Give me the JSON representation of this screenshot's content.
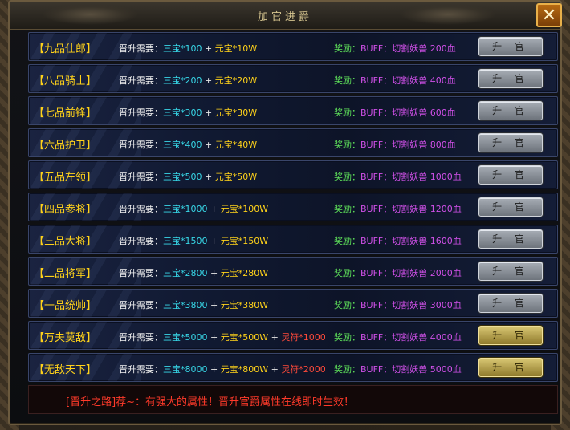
{
  "window": {
    "title": "加官进爵",
    "close_label": "✕"
  },
  "rows": [
    {
      "rank": "【九品仕郎】",
      "req_label": "晋升需要：",
      "sanbao": "三宝*100",
      "plus1": " + ",
      "yuanbao": "元宝*10W",
      "plus2": "",
      "lingfu": "",
      "reward_label": "奖励：",
      "reward_text": "BUFF：切割妖兽 200血",
      "button": "升 官",
      "button_style": "gray"
    },
    {
      "rank": "【八品骑士】",
      "req_label": "晋升需要：",
      "sanbao": "三宝*200",
      "plus1": " + ",
      "yuanbao": "元宝*20W",
      "plus2": "",
      "lingfu": "",
      "reward_label": "奖励：",
      "reward_text": "BUFF：切割妖兽 400血",
      "button": "升 官",
      "button_style": "gray"
    },
    {
      "rank": "【七品前锋】",
      "req_label": "晋升需要：",
      "sanbao": "三宝*300",
      "plus1": " + ",
      "yuanbao": "元宝*30W",
      "plus2": "",
      "lingfu": "",
      "reward_label": "奖励：",
      "reward_text": "BUFF：切割妖兽 600血",
      "button": "升 官",
      "button_style": "gray"
    },
    {
      "rank": "【六品护卫】",
      "req_label": "晋升需要：",
      "sanbao": "三宝*400",
      "plus1": " + ",
      "yuanbao": "元宝*40W",
      "plus2": "",
      "lingfu": "",
      "reward_label": "奖励：",
      "reward_text": "BUFF：切割妖兽 800血",
      "button": "升 官",
      "button_style": "gray"
    },
    {
      "rank": "【五品左领】",
      "req_label": "晋升需要：",
      "sanbao": "三宝*500",
      "plus1": " + ",
      "yuanbao": "元宝*50W",
      "plus2": "",
      "lingfu": "",
      "reward_label": "奖励：",
      "reward_text": "BUFF：切割妖兽 1000血",
      "button": "升 官",
      "button_style": "gray"
    },
    {
      "rank": "【四品参将】",
      "req_label": "晋升需要：",
      "sanbao": "三宝*1000",
      "plus1": " + ",
      "yuanbao": "元宝*100W",
      "plus2": "",
      "lingfu": "",
      "reward_label": "奖励：",
      "reward_text": "BUFF：切割妖兽 1200血",
      "button": "升 官",
      "button_style": "gray"
    },
    {
      "rank": "【三品大将】",
      "req_label": "晋升需要：",
      "sanbao": "三宝*1500",
      "plus1": " + ",
      "yuanbao": "元宝*150W",
      "plus2": "",
      "lingfu": "",
      "reward_label": "奖励：",
      "reward_text": "BUFF：切割妖兽 1600血",
      "button": "升 官",
      "button_style": "gray"
    },
    {
      "rank": "【二品将军】",
      "req_label": "晋升需要：",
      "sanbao": "三宝*2800",
      "plus1": " + ",
      "yuanbao": "元宝*280W",
      "plus2": "",
      "lingfu": "",
      "reward_label": "奖励：",
      "reward_text": "BUFF：切割妖兽 2000血",
      "button": "升 官",
      "button_style": "gray"
    },
    {
      "rank": "【一品统帅】",
      "req_label": "晋升需要：",
      "sanbao": "三宝*3800",
      "plus1": " + ",
      "yuanbao": "元宝*380W",
      "plus2": "",
      "lingfu": "",
      "reward_label": "奖励：",
      "reward_text": "BUFF：切割妖兽 3000血",
      "button": "升 官",
      "button_style": "gray"
    },
    {
      "rank": "【万夫莫敌】",
      "req_label": "晋升需要：",
      "sanbao": "三宝*5000",
      "plus1": " + ",
      "yuanbao": "元宝*500W",
      "plus2": " + ",
      "lingfu": "灵符*1000",
      "reward_label": "奖励：",
      "reward_text": "BUFF：切割妖兽 4000血",
      "button": "升 官",
      "button_style": "gold"
    },
    {
      "rank": "【无敌天下】",
      "req_label": "晋升需要：",
      "sanbao": "三宝*8000",
      "plus1": " + ",
      "yuanbao": "元宝*800W",
      "plus2": " + ",
      "lingfu": "灵符*2000",
      "reward_label": "奖励：",
      "reward_text": "BUFF：切割妖兽 5000血",
      "button": "升 官",
      "button_style": "gold"
    }
  ],
  "footer": {
    "text": "[晋升之路]荐~：有强大的属性！晋升官爵属性在线即时生效！"
  }
}
